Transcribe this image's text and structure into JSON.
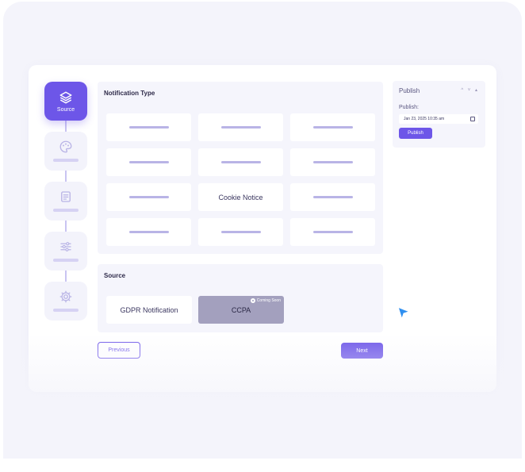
{
  "stepper": {
    "steps": [
      {
        "label": "Source",
        "icon": "layers-icon",
        "active": true
      },
      {
        "label": "",
        "icon": "palette-icon",
        "active": false
      },
      {
        "label": "",
        "icon": "document-icon",
        "active": false
      },
      {
        "label": "",
        "icon": "sliders-icon",
        "active": false
      },
      {
        "label": "",
        "icon": "gear-icon",
        "active": false
      }
    ]
  },
  "notification_type": {
    "title": "Notification Type",
    "options": [
      "",
      "",
      "",
      "",
      "",
      "",
      "",
      "Cookie Notice",
      "",
      "",
      "",
      ""
    ]
  },
  "source": {
    "title": "Source",
    "options": [
      {
        "label": "GDPR Notification",
        "disabled": false
      },
      {
        "label": "CCPA",
        "disabled": true,
        "badge": "Coming Soon"
      }
    ]
  },
  "actions": {
    "previous": "Previous",
    "next": "Next"
  },
  "publish": {
    "title": "Publish",
    "controls": "^ ˅ ▴",
    "label": "Publish:",
    "date_value": "Jan 23, 2025 10:35 am",
    "button": "Publish"
  },
  "colors": {
    "accent": "#6d56e8",
    "panel": "#f5f5fc",
    "disabled": "#a3a0be"
  }
}
